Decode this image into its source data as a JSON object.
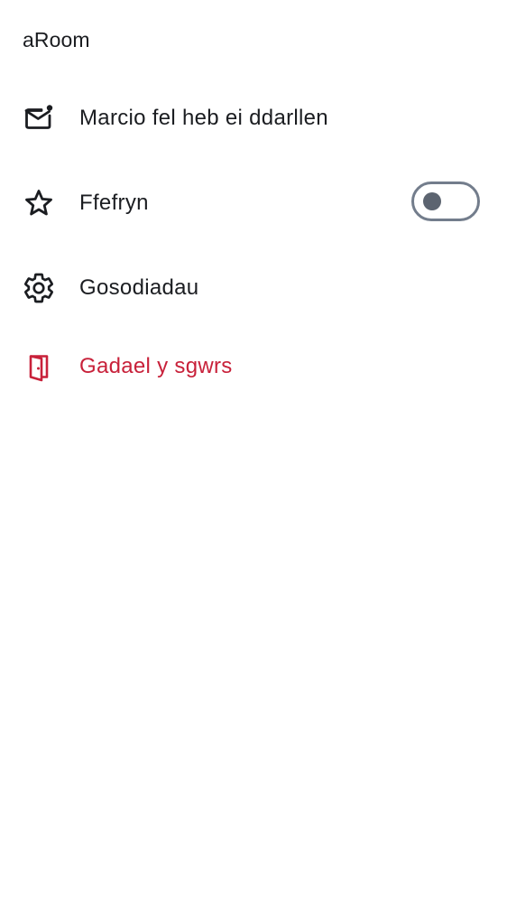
{
  "room": {
    "name": "aRoom"
  },
  "menu": {
    "mark_unread": {
      "label": "Marcio fel heb ei ddarllen",
      "icon": "mail-unread-icon"
    },
    "favourite": {
      "label": "Ffefryn",
      "icon": "star-icon",
      "toggle_on": false
    },
    "settings": {
      "label": "Gosodiadau",
      "icon": "gear-icon"
    },
    "leave": {
      "label": "Gadael y sgwrs",
      "icon": "leave-door-icon",
      "color": "#c8213a"
    }
  },
  "colors": {
    "text": "#1b1d21",
    "danger": "#c8213a",
    "toggle_border": "#737d8c",
    "toggle_knob": "#5c6470"
  }
}
